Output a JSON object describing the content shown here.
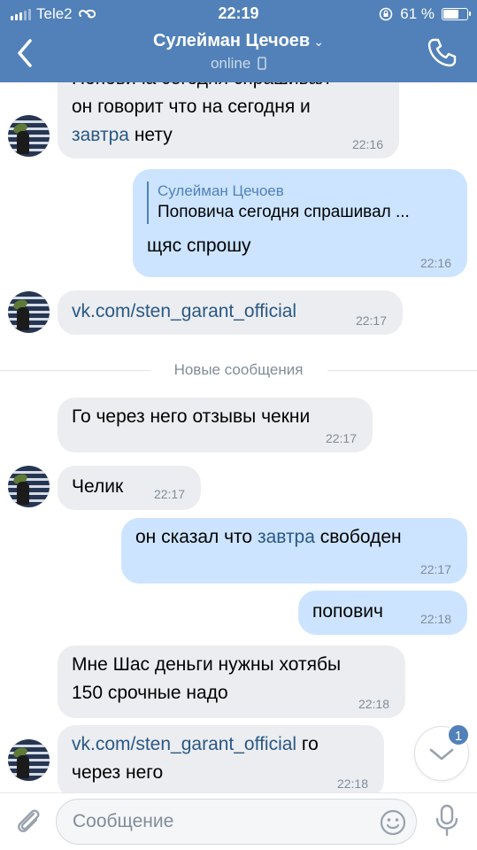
{
  "status_bar": {
    "carrier": "Tele2",
    "time": "22:19",
    "battery_percent": "61 %",
    "battery_level": 0.61
  },
  "header": {
    "contact_name": "Сулейман Цечоев",
    "status": "online",
    "icons": [
      "back-chevron-icon",
      "chevron-down-icon",
      "mobile-icon",
      "phone-icon"
    ]
  },
  "messages": [
    {
      "dir": "in",
      "line1": "Поповича сегодня спрашивал",
      "line2": "он говорит что на сегодня и",
      "link": "завтра",
      "tail": " нету",
      "time": "22:16"
    },
    {
      "dir": "out",
      "reply_name": "Сулейман Цечоев",
      "reply_text": "Поповича сегодня спрашивал ...",
      "text": "щяс спрошу",
      "time": "22:16"
    },
    {
      "dir": "in",
      "link": "vk.com/sten_garant_official",
      "time": "22:17"
    },
    {
      "dir": "in",
      "text": "Го через него отзывы чекни",
      "time": "22:17"
    },
    {
      "dir": "in",
      "text": "Челик",
      "time": "22:17"
    },
    {
      "dir": "out",
      "pre": "он сказал что ",
      "link": "завтра",
      "post": " свободен",
      "time": "22:17"
    },
    {
      "dir": "out",
      "text": "попович",
      "time": "22:18"
    },
    {
      "dir": "in",
      "line1": "Мне Шас деньги нужны хотябы",
      "line2": "150 срочные надо",
      "time": "22:18"
    },
    {
      "dir": "in",
      "link": "vk.com/sten_garant_official",
      "post": " го",
      "line2": "через него",
      "time": "22:18"
    }
  ],
  "divider": {
    "label": "Новые сообщения"
  },
  "scroll_button": {
    "badge": "1"
  },
  "composer": {
    "placeholder": "Сообщение",
    "value": ""
  },
  "colors": {
    "header": "#5181b8",
    "incoming_bubble": "#ebedf0",
    "outgoing_bubble": "#cce4ff",
    "link": "#2a5885",
    "timestamp": "#818c99"
  }
}
